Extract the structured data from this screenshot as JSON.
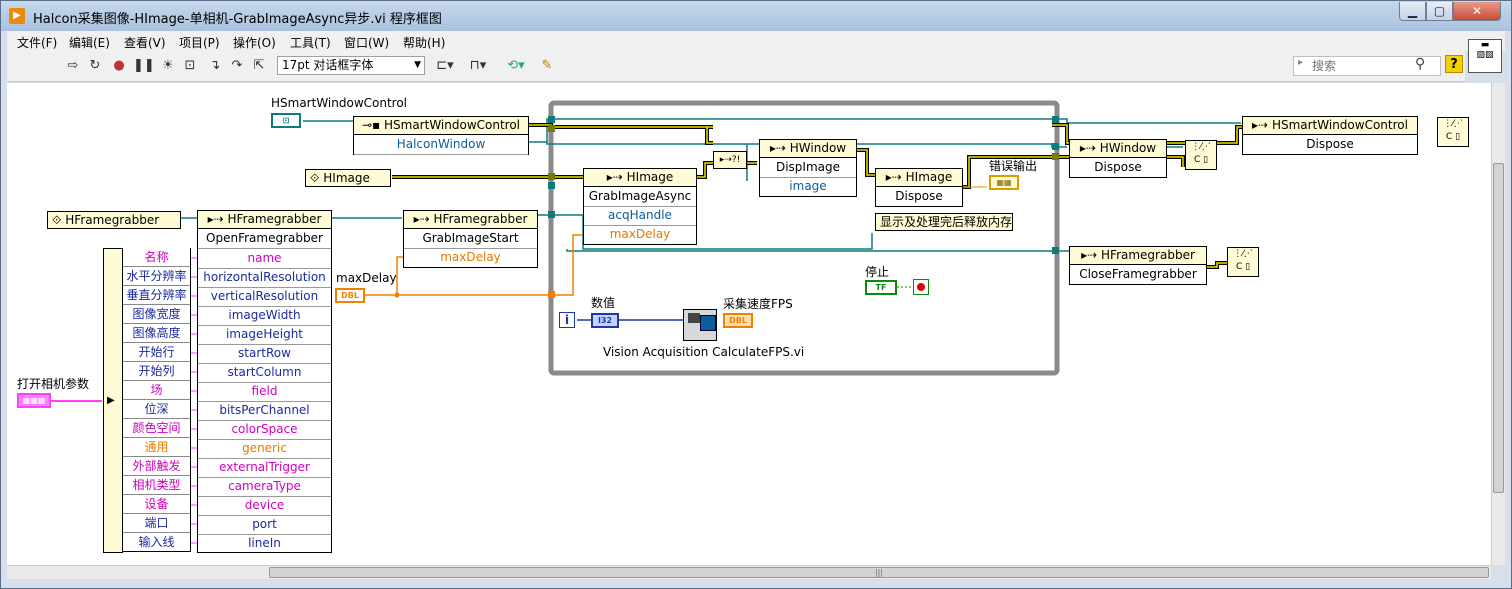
{
  "window": {
    "title": "Halcon采集图像-HImage-单相机-GrabImageAsync异步.vi 程序框图",
    "minimize_label": "▁",
    "maximize_label": "▢",
    "close_label": "✕"
  },
  "menu": {
    "items": [
      "文件(F)",
      "编辑(E)",
      "查看(V)",
      "项目(P)",
      "操作(O)",
      "工具(T)",
      "窗口(W)",
      "帮助(H)"
    ]
  },
  "toolbar": {
    "font_value": "17pt 对话框字体",
    "search_placeholder": "搜索",
    "help_label": "?"
  },
  "diagram": {
    "labels": {
      "hsmart_control": "HSmartWindowControl",
      "open_params": "打开相机参数",
      "max_delay": "maxDelay",
      "value_label": "数值",
      "fps_label": "采集速度FPS",
      "stop_label": "停止",
      "error_out": "错误输出",
      "display_comment": "显示及处理完后释放内存",
      "calc_fps": "Vision Acquisition CalculateFPS.vi"
    },
    "constants": {
      "himage": "HImage",
      "hframegrabber": "HFramegrabber"
    },
    "nodes": {
      "hsmart_property": {
        "title": "HSmartWindowControl",
        "row": "HalconWindow"
      },
      "open_fg": {
        "title": "HFramegrabber",
        "method": "OpenFramegrabber",
        "params": [
          "name",
          "horizontalResolution",
          "verticalResolution",
          "imageWidth",
          "imageHeight",
          "startRow",
          "startColumn",
          "field",
          "bitsPerChannel",
          "colorSpace",
          "generic",
          "externalTrigger",
          "cameraType",
          "device",
          "port",
          "lineIn"
        ]
      },
      "grab_start": {
        "title": "HFramegrabber",
        "method": "GrabImageStart",
        "param": "maxDelay"
      },
      "grab_async": {
        "title": "HImage",
        "method": "GrabImageAsync",
        "params": [
          "acqHandle",
          "maxDelay"
        ]
      },
      "disp_image": {
        "title": "HWindow",
        "method": "DispImage",
        "param": "image"
      },
      "himage_dispose": {
        "title": "HImage",
        "method": "Dispose"
      },
      "hwindow_dispose": {
        "title": "HWindow",
        "method": "Dispose"
      },
      "hsmart_dispose": {
        "title": "HSmartWindowControl",
        "method": "Dispose"
      },
      "close_fg": {
        "title": "HFramegrabber",
        "method": "CloseFramegrabber"
      }
    },
    "cluster": {
      "labels": [
        "名称",
        "水平分辨率",
        "垂直分辨率",
        "图像宽度",
        "图像高度",
        "开始行",
        "开始列",
        "场",
        "位深",
        "颜色空间",
        "通用",
        "外部触发",
        "相机类型",
        "设备",
        "端口",
        "输入线"
      ]
    },
    "terminals": {
      "dbl": "DBL",
      "i32": "I32",
      "tf": "TF",
      "loop_i": "i"
    }
  }
}
